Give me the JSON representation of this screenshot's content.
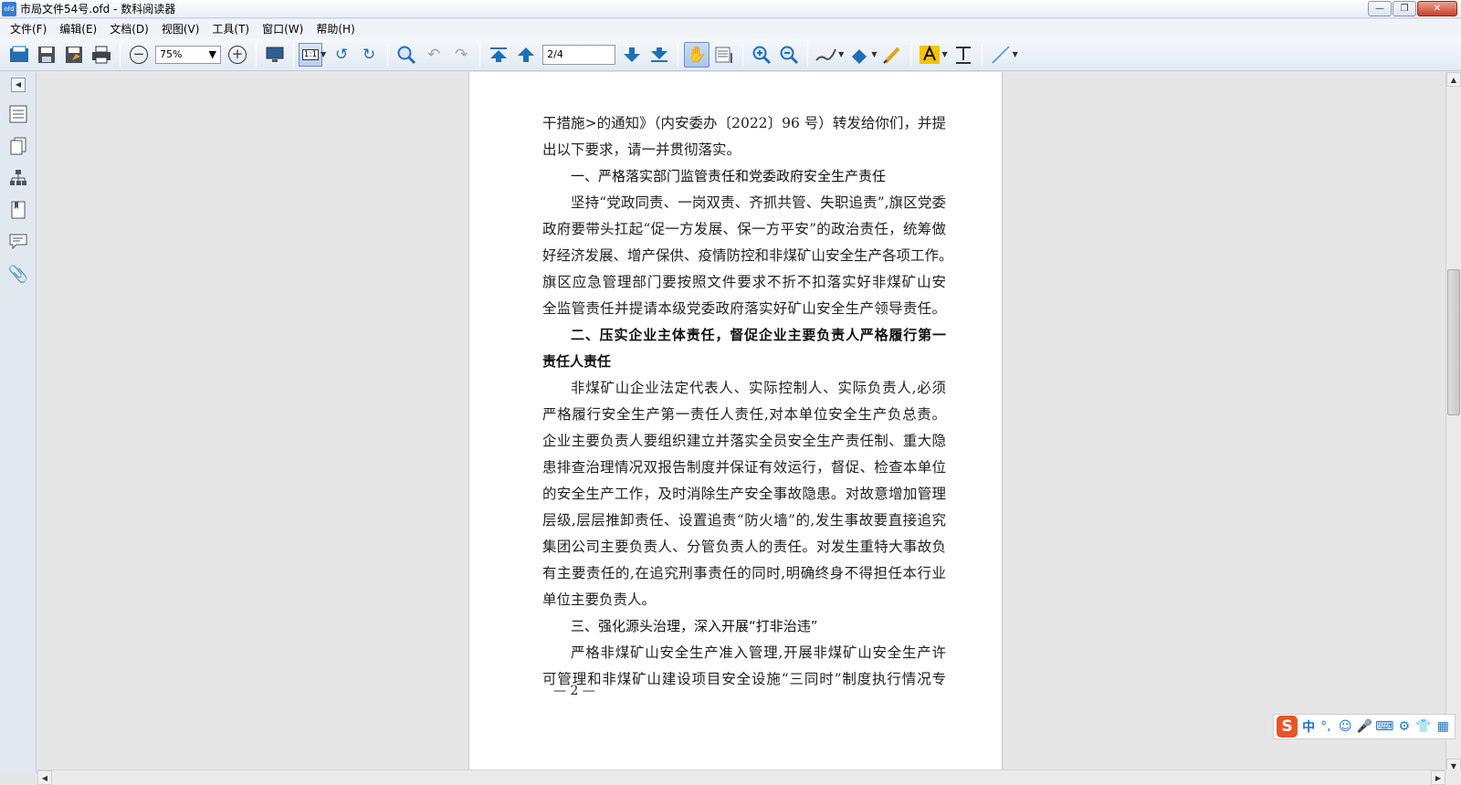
{
  "window": {
    "app_icon_text": "ofd",
    "title": "市局文件54号.ofd - 数科阅读器"
  },
  "menu": [
    "文件(F)",
    "编辑(E)",
    "文档(D)",
    "视图(V)",
    "工具(T)",
    "窗口(W)",
    "帮助(H)"
  ],
  "toolbar": {
    "zoom_value": "75%",
    "actual_size_label": "1:1",
    "page_indicator": "2/4"
  },
  "document": {
    "lines": [
      {
        "text": "干措施>的通知》（内安委办〔2022〕96 号）转发给你们，并提",
        "style": "body"
      },
      {
        "text": "出以下要求，请一并贯彻落实。",
        "style": "body-last"
      },
      {
        "text": "一、严格落实部门监管责任和党委政府安全生产责任",
        "style": "heading-plain-indent"
      },
      {
        "text": "坚持“党政同责、一岗双责、齐抓共管、失职追责”,旗区党委",
        "style": "body-indent"
      },
      {
        "text": "政府要带头扛起“促一方发展、保一方平安”的政治责任，统筹做",
        "style": "body"
      },
      {
        "text": "好经济发展、增产保供、疫情防控和非煤矿山安全生产各项工作。",
        "style": "body"
      },
      {
        "text": "旗区应急管理部门要按照文件要求不折不扣落实好非煤矿山安",
        "style": "body"
      },
      {
        "text": "全监管责任并提请本级党委政府落实好矿山安全生产领导责任。",
        "style": "body"
      },
      {
        "text": "二、压实企业主体责任，督促企业主要负责人严格履行第一",
        "style": "heading-indent"
      },
      {
        "text": "责任人责任",
        "style": "heading-last"
      },
      {
        "text": "非煤矿山企业法定代表人、实际控制人、实际负责人,必须",
        "style": "body-indent"
      },
      {
        "text": "严格履行安全生产第一责任人责任,对本单位安全生产负总责。",
        "style": "body"
      },
      {
        "text": "企业主要负责人要组织建立并落实全员安全生产责任制、重大隐",
        "style": "body"
      },
      {
        "text": "患排查治理情况双报告制度并保证有效运行，督促、检查本单位",
        "style": "body"
      },
      {
        "text": "的安全生产工作，及时消除生产安全事故隐患。对故意增加管理",
        "style": "body"
      },
      {
        "text": "层级,层层推卸责任、设置追责“防火墙”的,发生事故要直接追究",
        "style": "body"
      },
      {
        "text": "集团公司主要负责人、分管负责人的责任。对发生重特大事故负",
        "style": "body"
      },
      {
        "text": "有主要责任的,在追究刑事责任的同时,明确终身不得担任本行业",
        "style": "body"
      },
      {
        "text": "单位主要负责人。",
        "style": "body-last"
      },
      {
        "text": "三、强化源头治理，深入开展“打非治违”",
        "style": "heading-plain-indent"
      },
      {
        "text": "严格非煤矿山安全生产准入管理,开展非煤矿山安全生产许",
        "style": "body-indent"
      },
      {
        "text": "可管理和非煤矿山建设项目安全设施“三同时”制度执行情况专",
        "style": "body"
      }
    ],
    "page_number": "— 2 —"
  },
  "ime": {
    "logo": "S",
    "mode": "中",
    "punct": "°,",
    "items": [
      "☺",
      "🎤",
      "⌨",
      "⚙",
      "👕",
      "▦"
    ]
  }
}
